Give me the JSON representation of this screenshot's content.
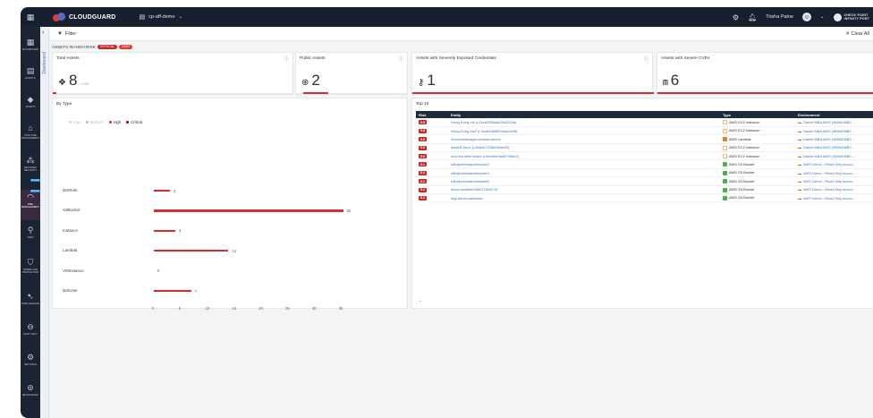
{
  "topbar": {
    "app_name": "CLOUDGUARD",
    "context": "cp-aff-demo",
    "user": "Trisha Paine",
    "vendor": "CHECK POINT",
    "vendor_sub": "INFINITY PORT"
  },
  "rail": [
    {
      "label": "Dashboard",
      "icon": "dashboard-icon"
    },
    {
      "label": "Events",
      "icon": "events-icon"
    },
    {
      "label": "Assets",
      "icon": "assets-icon"
    },
    {
      "label": "Posture Management",
      "icon": "posture-icon"
    },
    {
      "label": "Network Security",
      "icon": "network-icon",
      "badge": "Preview"
    },
    {
      "label": "Risk Management",
      "icon": "risk-icon",
      "badge": "Preview",
      "active": true
    },
    {
      "label": "CIEM",
      "icon": "ciem-icon"
    },
    {
      "label": "Workload Protection",
      "icon": "workload-icon"
    },
    {
      "label": "Intelligence",
      "icon": "intelligence-icon"
    },
    {
      "label": "Shift Left",
      "icon": "shift-left-icon"
    },
    {
      "label": "Settings",
      "icon": "settings-icon"
    },
    {
      "label": "Resources",
      "icon": "resources-icon"
    }
  ],
  "subrail": {
    "label": "Dashboard"
  },
  "filter": {
    "label": "Filter",
    "clear": "Clear All"
  },
  "tags": {
    "label": "ASSETS IN HIGH RISK",
    "pills": [
      {
        "text": "CRITICAL"
      },
      {
        "text": "HIGH"
      }
    ]
  },
  "kpis": [
    {
      "title": "Total Assets",
      "value": "8",
      "sub": "/ 1016"
    },
    {
      "title": "Public Assets",
      "value": "2",
      "sub": ""
    },
    {
      "title": "Assets with Severely Exposed Credentials",
      "value": "1",
      "sub": ""
    },
    {
      "title": "Assets with Severe CVEs",
      "value": "6",
      "sub": ""
    }
  ],
  "by_type": {
    "title": "By Type",
    "legend": [
      "Low",
      "Medium",
      "High",
      "Critical"
    ],
    "colors": {
      "low": "#d8d8d8",
      "medium": "#bdbdbd",
      "high": "#d32f2f",
      "critical": "#8b0000"
    }
  },
  "chart_data": {
    "type": "bar",
    "orientation": "horizontal",
    "categories": [
      "lamRole",
      "S3Bucket",
      "Instance",
      "Lambda",
      "VMInstance",
      "lamUser"
    ],
    "series": [
      {
        "name": "High",
        "values": [
          3,
          52,
          4,
          14,
          0,
          7
        ]
      }
    ],
    "xticks": [
      0,
      5,
      10,
      15,
      20,
      25,
      30,
      35
    ],
    "xlim": [
      0,
      35
    ]
  },
  "top10": {
    "title": "Top 10",
    "columns": [
      "Risk",
      "Entity",
      "Type",
      "Environment"
    ],
    "rows": [
      {
        "risk": "9.8",
        "entity": "Hong-Kong Ins (i-01cd33f0dab20c0223d)",
        "type": "AWS EC2 Instance",
        "type_kind": "ec2",
        "env": "Daniel MBA AWS (9694006B2..."
      },
      {
        "risk": "9.8",
        "entity": "Hong-Kong Ins2 (i-0ce83de8f90d4ad2cf5)",
        "type": "AWS EC2 Instance",
        "type_kind": "ec2",
        "env": "Daniel MBA AWS (9694006B2..."
      },
      {
        "risk": "9.6",
        "entity": "ServiceManager-lambda-secret",
        "type": "AWS Lambda",
        "type_kind": "lambda",
        "env": "Daniel MBA AWS (9694006B2..."
      },
      {
        "risk": "9.6",
        "entity": "daniel1-linux (i-0fae62723ab9bde80)",
        "type": "AWS EC2 Instance",
        "type_kind": "ec2",
        "env": "Daniel MBA AWS (9694006B2..."
      },
      {
        "risk": "9.6",
        "entity": "new-ins-after-share (i-0ee43e0a4d7306e2)",
        "type": "AWS EC2 Instance",
        "type_kind": "ec2",
        "env": "Daniel MBA AWS (9694006B2..."
      },
      {
        "risk": "8.1",
        "entity": "s3fullpermissionbucket3",
        "type": "AWS S3 Bucket",
        "type_kind": "s3",
        "env": "AWS Demo - Read Only accou..."
      },
      {
        "risk": "8.1",
        "entity": "s3fullpermissionbucket4",
        "type": "AWS S3 Bucket",
        "type_kind": "s3",
        "env": "AWS Demo - Read Only accou..."
      },
      {
        "risk": "8.1",
        "entity": "s3fullpermissionbucket5",
        "type": "AWS S3 Bucket",
        "type_kind": "s3",
        "env": "AWS Demo - Read Only accou..."
      },
      {
        "risk": "8.1",
        "entity": "ibuce-webkiler0960719b8719",
        "type": "AWS S3 Bucket",
        "type_kind": "s3",
        "env": "AWS Demo - Read Only accou..."
      },
      {
        "risk": "8.1",
        "entity": "mgt-demo-webstore",
        "type": "AWS S3 Bucket",
        "type_kind": "s3",
        "env": "AWS Demo - Read Only accou..."
      }
    ]
  },
  "colors": {
    "accent": "#d32f2f",
    "topbar": "#17202f",
    "link": "#3d72c4",
    "table_header": "#1f2a3c"
  }
}
